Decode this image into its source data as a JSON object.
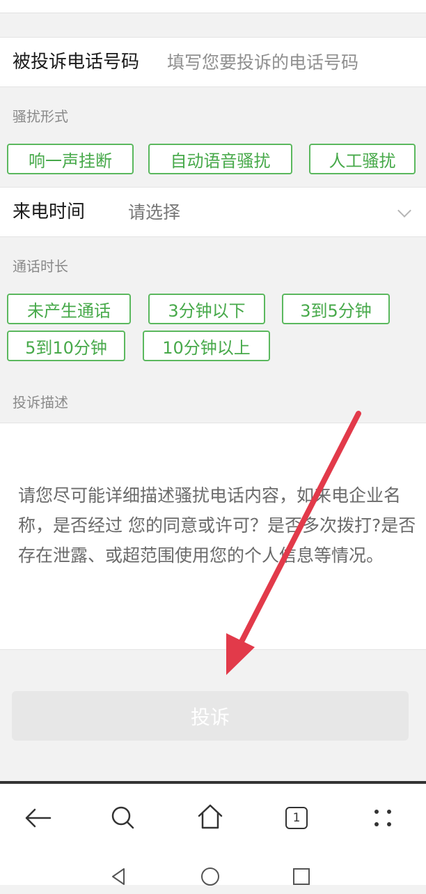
{
  "form": {
    "phone_label": "被投诉电话号码",
    "phone_placeholder": "填写您要投诉的电话号码",
    "harass_title": "骚扰形式",
    "harass_options": [
      "响一声挂断",
      "自动语音骚扰",
      "人工骚扰"
    ],
    "time_label": "来电时间",
    "time_value": "请选择",
    "duration_title": "通话时长",
    "duration_options": [
      "未产生通话",
      "3分钟以下",
      "3到5分钟",
      "5到10分钟",
      "10分钟以上"
    ],
    "desc_title": "投诉描述",
    "desc_placeholder": "请您尽可能详细描述骚扰电话内容，如来电企业名称，是否经过 您的同意或许可？是否多次拨打?是否存在泄露、或超范围使用您的个人信息等情况。",
    "submit_label": "投诉"
  },
  "browser": {
    "tab_count": "1",
    "icons": [
      "back-arrow-icon",
      "search-icon",
      "home-icon",
      "tabs-icon",
      "more-icon"
    ]
  },
  "system_nav": {
    "icons": [
      "back-triangle-icon",
      "home-circle-icon",
      "recents-square-icon"
    ]
  },
  "annotation": {
    "arrow_color": "#e23a4a"
  },
  "colors": {
    "accent": "#5bb85e",
    "chip_text": "#47a94a"
  }
}
